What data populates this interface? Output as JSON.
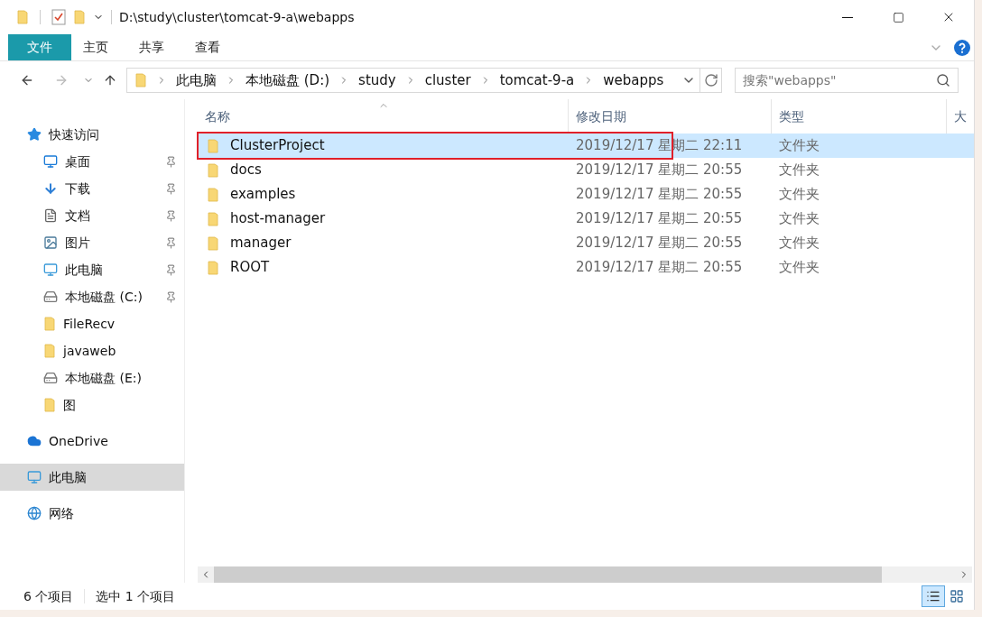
{
  "window": {
    "path": "D:\\study\\cluster\\tomcat-9-a\\webapps"
  },
  "ribbon_tabs": [
    {
      "label": "文件",
      "selected": true
    },
    {
      "label": "主页",
      "selected": false
    },
    {
      "label": "共享",
      "selected": false
    },
    {
      "label": "查看",
      "selected": false
    }
  ],
  "breadcrumb": [
    "此电脑",
    "本地磁盘 (D:)",
    "study",
    "cluster",
    "tomcat-9-a",
    "webapps"
  ],
  "search": {
    "placeholder": "搜索\"webapps\""
  },
  "sidebar": {
    "items": [
      {
        "label": "快速访问",
        "kind": "star",
        "pinned": false,
        "selected": false,
        "children": [
          {
            "label": "桌面",
            "kind": "desktop",
            "pinned": true,
            "selected": false
          },
          {
            "label": "下载",
            "kind": "download",
            "pinned": true,
            "selected": false
          },
          {
            "label": "文档",
            "kind": "document",
            "pinned": true,
            "selected": false
          },
          {
            "label": "图片",
            "kind": "image",
            "pinned": true,
            "selected": false
          },
          {
            "label": "此电脑",
            "kind": "computer",
            "pinned": true,
            "selected": false
          },
          {
            "label": "本地磁盘 (C:)",
            "kind": "drive",
            "pinned": true,
            "selected": false
          },
          {
            "label": "FileRecv",
            "kind": "folder",
            "pinned": false,
            "selected": false
          },
          {
            "label": "javaweb",
            "kind": "folder",
            "pinned": false,
            "selected": false
          },
          {
            "label": "本地磁盘 (E:)",
            "kind": "drive",
            "pinned": false,
            "selected": false
          },
          {
            "label": "图",
            "kind": "folder",
            "pinned": false,
            "selected": false
          }
        ]
      },
      {
        "label": "OneDrive",
        "kind": "cloud",
        "pinned": false,
        "selected": false
      },
      {
        "label": "此电脑",
        "kind": "computer",
        "pinned": false,
        "selected": true
      },
      {
        "label": "网络",
        "kind": "network",
        "pinned": false,
        "selected": false
      }
    ]
  },
  "table": {
    "columns": [
      "名称",
      "修改日期",
      "类型",
      "大"
    ],
    "rows": [
      {
        "name": "ClusterProject",
        "date": "2019/12/17 星期二 22:11",
        "type": "文件夹",
        "selected": true,
        "highlighted": true
      },
      {
        "name": "docs",
        "date": "2019/12/17 星期二 20:55",
        "type": "文件夹",
        "selected": false,
        "highlighted": false
      },
      {
        "name": "examples",
        "date": "2019/12/17 星期二 20:55",
        "type": "文件夹",
        "selected": false,
        "highlighted": false
      },
      {
        "name": "host-manager",
        "date": "2019/12/17 星期二 20:55",
        "type": "文件夹",
        "selected": false,
        "highlighted": false
      },
      {
        "name": "manager",
        "date": "2019/12/17 星期二 20:55",
        "type": "文件夹",
        "selected": false,
        "highlighted": false
      },
      {
        "name": "ROOT",
        "date": "2019/12/17 星期二 20:55",
        "type": "文件夹",
        "selected": false,
        "highlighted": false
      }
    ]
  },
  "status_bar": {
    "count": "6 个项目",
    "selection": "选中 1 个项目"
  }
}
